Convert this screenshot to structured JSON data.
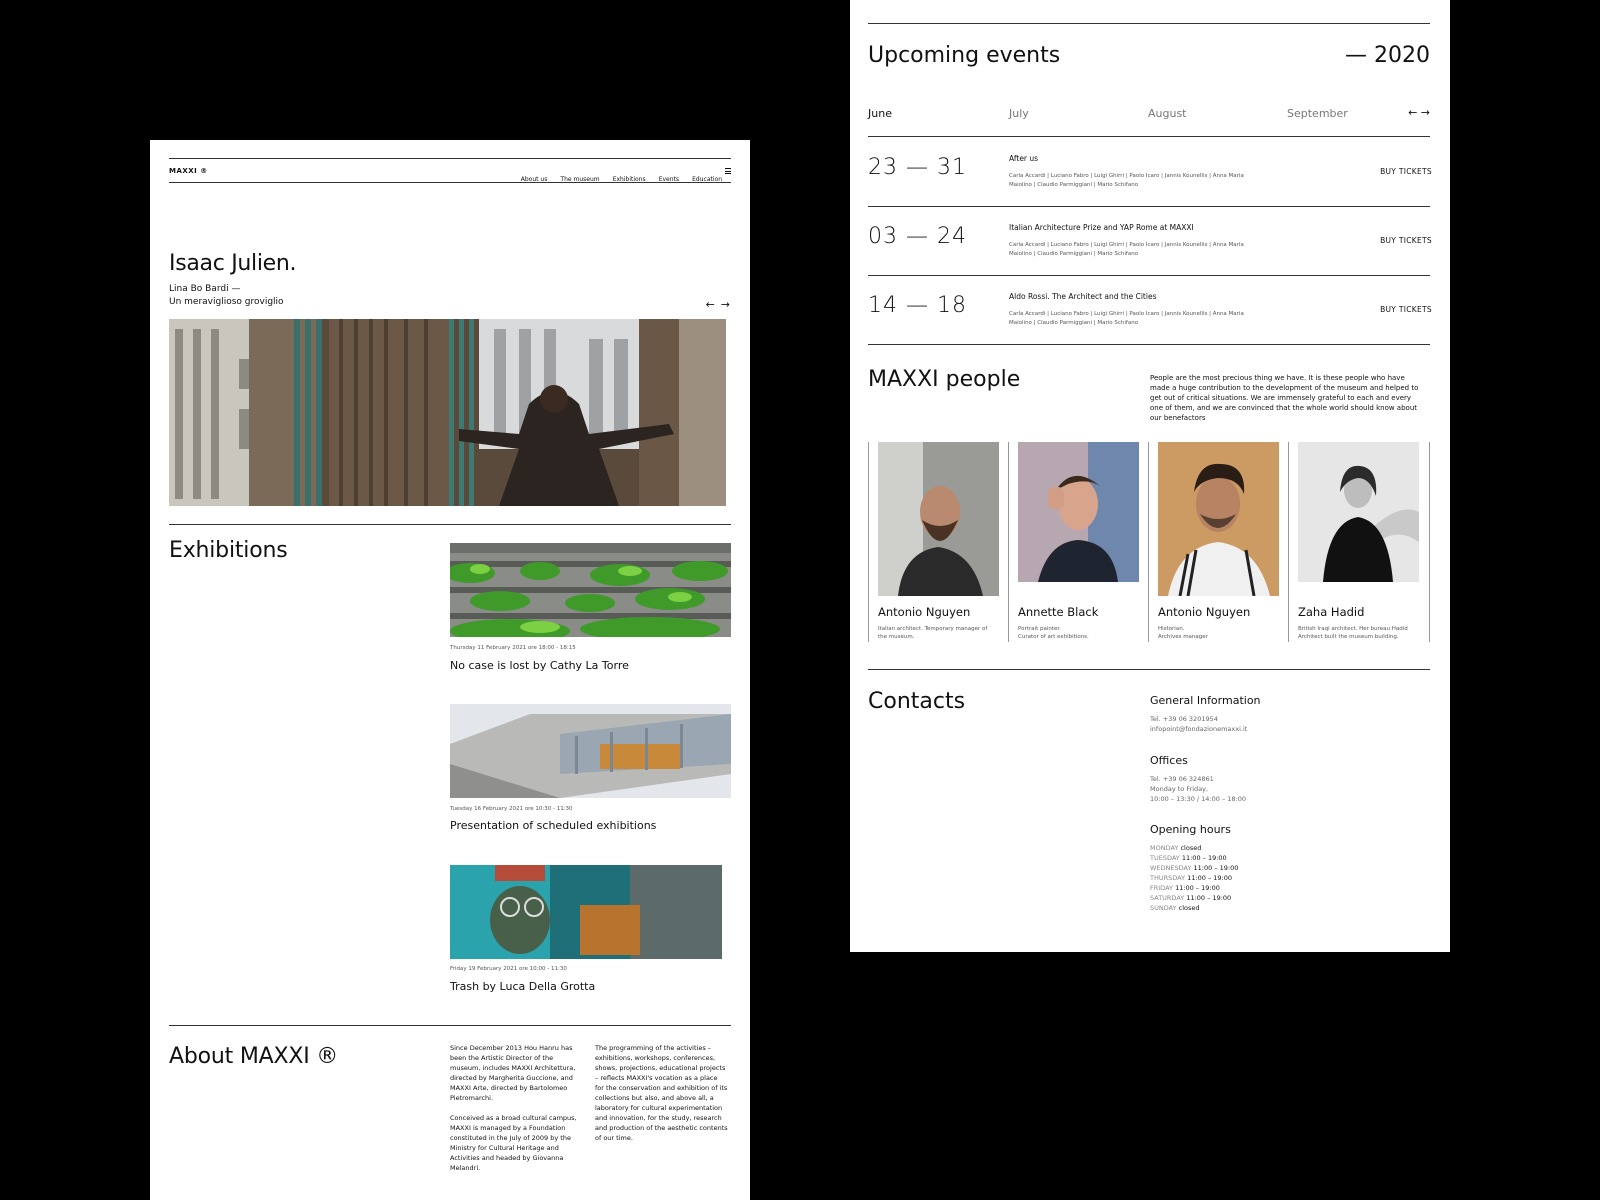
{
  "home": {
    "logo": "MAXXI ®",
    "nav": [
      "About us",
      "The museum",
      "Exhibitions",
      "Events",
      "Education"
    ],
    "menu_icon": "hamburger-menu-icon",
    "hero": {
      "title": "Isaac Julien.",
      "subtitle_line1": "Lina Bo Bardi —",
      "subtitle_line2": "Un meraviglioso groviglio",
      "prev_icon": "arrow-left-icon",
      "next_icon": "arrow-right-icon"
    },
    "exhibitions": {
      "heading": "Exhibitions",
      "items": [
        {
          "date": "Thursday 11 February 2021 ore 18:00 - 18:15",
          "title": "No case is lost by Cathy La Torre"
        },
        {
          "date": "Tuesday 16 February 2021 ore 10:30 - 11:30",
          "title": "Presentation of scheduled exhibitions"
        },
        {
          "date": "Friday 19 February 2021 ore 10:00 - 11:30",
          "title": "Trash by Luca Della Grotta"
        }
      ]
    },
    "about": {
      "heading": "About MAXXI ®",
      "col1_p1": "Since December 2013 Hou Hanru has been the Artistic Director of the museum, includes MAXXI Architettura, directed by Margherita Guccione, and MAXXI Arte, directed by Bartolomeo Pietromarchi.",
      "col1_p2": "Conceived as a broad cultural campus, MAXXI is managed by a Foundation constituted in the July of 2009 by the Ministry for Cultural Heritage and Activities and headed by Giovanna Melandri.",
      "col2_p1": "The programming of the activities – exhibitions, workshops, conferences, shows, projections, educational projects – reflects MAXXI's vocation as a place for the conservation and exhibition of its collections but also, and above all, a laboratory for cultural experimentation and innovation, for the study, research and production of the aesthetic contents of our time."
    }
  },
  "events": {
    "heading": "Upcoming events",
    "year": "— 2020",
    "months": [
      "June",
      "July",
      "August",
      "September"
    ],
    "active_month": "June",
    "prev_icon": "arrow-left-icon",
    "next_icon": "arrow-right-icon",
    "items": [
      {
        "dates": "23 — 31",
        "name": "After us",
        "people_line1": "Carla Accardi | Luciano Fabro | Luigi Ghirri | Paolo Icaro | Jannis Kounellis | Anna Maria",
        "people_line2": "Maiolino | Claudio Parmiggiani | Mario Schifano",
        "cta": "BUY TICKETS"
      },
      {
        "dates": "03 — 24",
        "name": "Italian Architecture Prize and YAP Rome at MAXXI",
        "people_line1": "Carla Accardi | Luciano Fabro | Luigi Ghirri | Paolo Icaro | Jannis Kounellis | Anna Maria",
        "people_line2": "Maiolino | Claudio Parmiggiani | Mario Schifano",
        "cta": "BUY TICKETS"
      },
      {
        "dates": "14 — 18",
        "name": "Aldo Rossi. The Architect and the Cities",
        "people_line1": "Carla Accardi | Luciano Fabro | Luigi Ghirri | Paolo Icaro | Jannis Kounellis | Anna Maria",
        "people_line2": "Maiolino | Claudio Parmiggiani | Mario Schifano",
        "cta": "BUY TICKETS"
      }
    ]
  },
  "people": {
    "heading": "MAXXI people",
    "intro": "People are the most precious thing we have. It is these people who have made a huge contribution to the development of the museum and helped to get out of critical situations. We are immensely grateful to each and every one of them, and we are convinced that the whole world should know about our benefactors",
    "items": [
      {
        "name": "Antonio Nguyen",
        "desc1": "Italian architect. Temporary manager of",
        "desc2": "the museum."
      },
      {
        "name": "Annette Black",
        "desc1": "Portrait painter.",
        "desc2": "Curator of art exhibitions."
      },
      {
        "name": "Antonio Nguyen",
        "desc1": "Historian.",
        "desc2": "Archives manager"
      },
      {
        "name": "Zaha Hadid",
        "desc1": "British Iraqi architect. Her bureau Hadid",
        "desc2": "Architect built the museum building."
      }
    ]
  },
  "contacts": {
    "heading": "Contacts",
    "general": {
      "title": "General Information",
      "phone": "Tel. +39 06 3201954",
      "email": "infopoint@fondazionemaxxi.it"
    },
    "offices": {
      "title": "Offices",
      "phone": "Tel. +39 06 324861",
      "days": "Monday to Friday,",
      "hours": "10:00 – 13:30 / 14:00 – 18:00"
    },
    "opening": {
      "title": "Opening hours",
      "rows": [
        {
          "day": "MONDAY",
          "value": "closed"
        },
        {
          "day": "TUESDAY",
          "value": "11:00 – 19:00"
        },
        {
          "day": "WEDNESDAY",
          "value": "11:00 – 19:00"
        },
        {
          "day": "THURSDAY",
          "value": "11:00 – 19:00"
        },
        {
          "day": "FRIDAY",
          "value": "11:00 – 19:00"
        },
        {
          "day": "SATURDAY",
          "value": "11:00 – 19:00"
        },
        {
          "day": "SUNDAY",
          "value": "closed"
        }
      ]
    }
  }
}
